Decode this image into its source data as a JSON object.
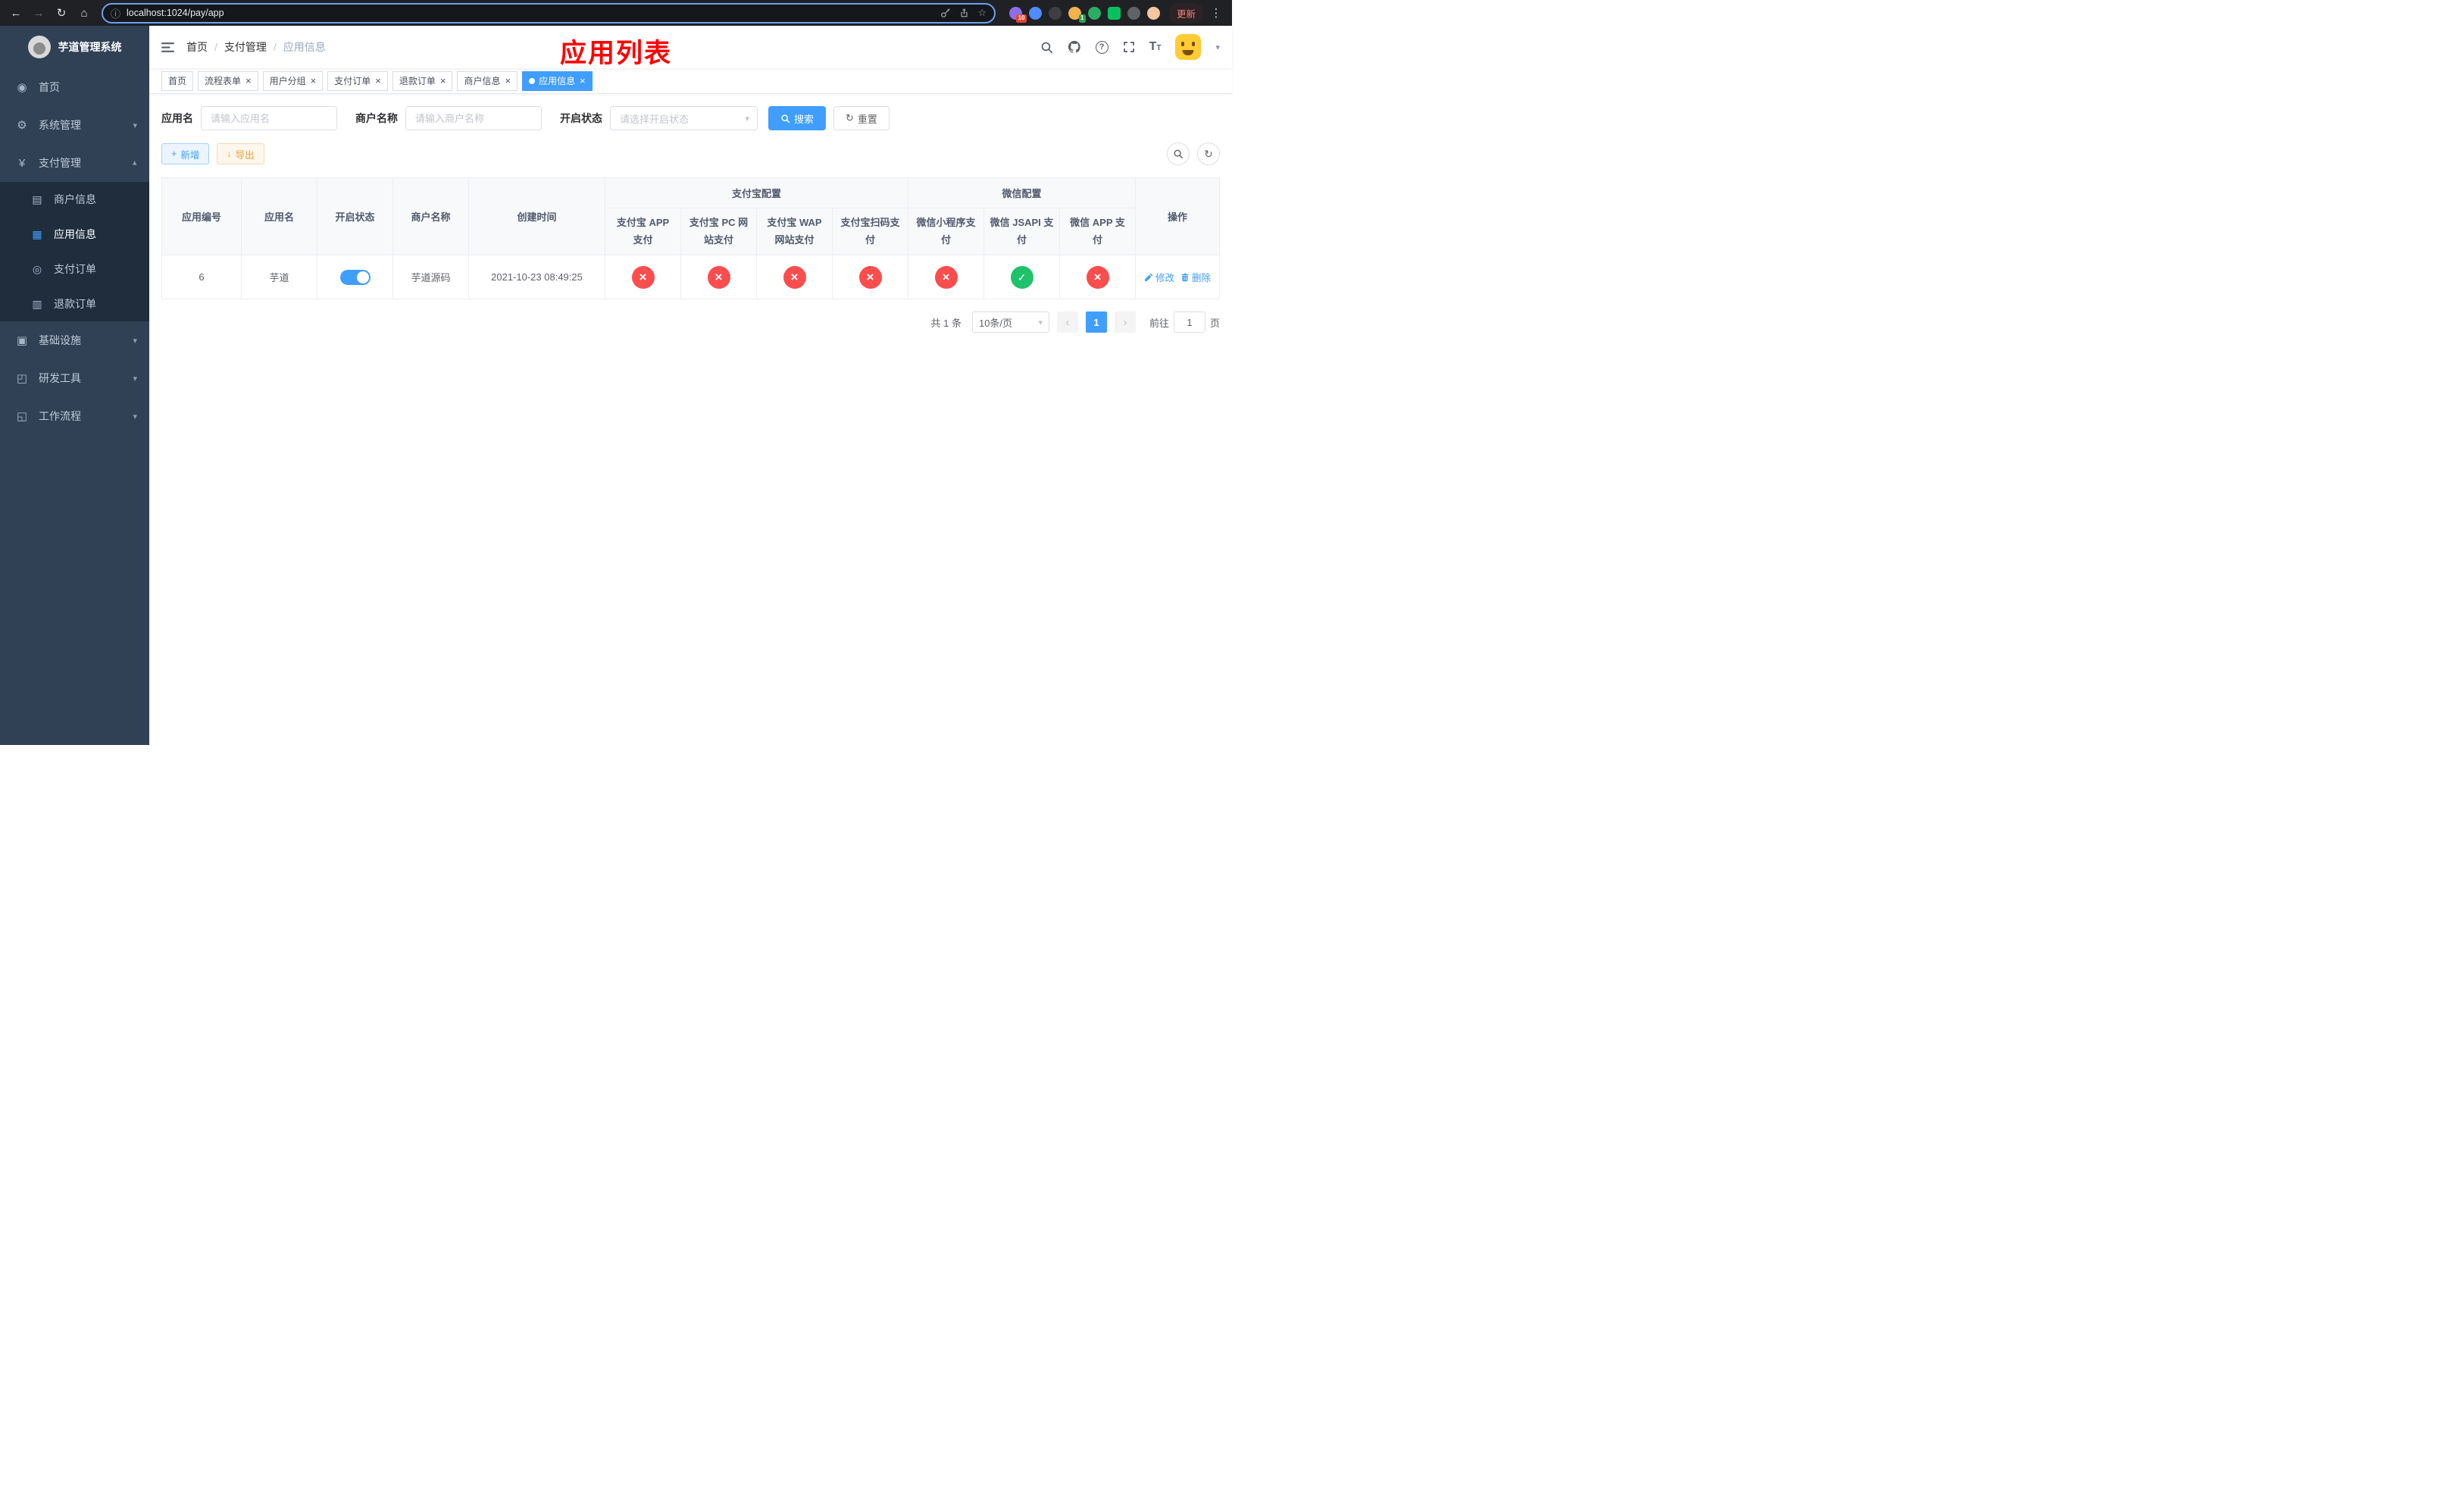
{
  "icons": {
    "back": "←",
    "forward": "→",
    "reload": "↻",
    "home": "⌂",
    "info": "ⓘ",
    "star": "☆",
    "kebab": "⋮",
    "close": "×",
    "caret_down": "▾",
    "check": "✓",
    "cross": "×",
    "plus": "+",
    "download": "↓",
    "refresh": "↻",
    "chevron_left": "‹",
    "chevron_right": "›",
    "question": "?"
  },
  "browser": {
    "url": "localhost:1024/pay/app",
    "update_button": "更新",
    "extensions": [
      {
        "name": "extensions-grid-icon",
        "color": "#8a6fe8",
        "badge": "10",
        "badge_color": "#e94235"
      },
      {
        "name": "extension-blue-icon",
        "color": "#4e8cff"
      },
      {
        "name": "extension-dark-circle-icon",
        "color": "#3c4043"
      },
      {
        "name": "extension-avatar-icon",
        "color": "#f2b24c",
        "badge": "1",
        "badge_color": "#2e9e4f"
      },
      {
        "name": "extension-green-circle-icon",
        "color": "#2aae67"
      },
      {
        "name": "extension-wechat-icon",
        "color": "#07c160",
        "square": true
      },
      {
        "name": "extension-gray-circle-icon",
        "color": "#5f6368"
      },
      {
        "name": "extension-profile-face-icon",
        "color": "#f4c7a0"
      }
    ]
  },
  "app": {
    "annotation": "应用列表",
    "colors": {
      "accent": "#409eff",
      "status_off": "#fb4d4d",
      "status_on": "#1fc26b",
      "annotation_red": "#ff0000",
      "export_orange": "#e6a23c"
    },
    "sidebar": {
      "logo_title": "芋道管理系统",
      "menu": [
        {
          "label": "首页",
          "icon": "dashboard-icon",
          "glyph": "◉",
          "type": "item"
        },
        {
          "label": "系统管理",
          "icon": "gear-icon",
          "glyph": "⚙",
          "type": "group",
          "expanded": false
        },
        {
          "label": "支付管理",
          "icon": "yen-icon",
          "glyph": "¥",
          "type": "group",
          "expanded": true,
          "children": [
            {
              "label": "商户信息",
              "icon": "merchant-card-icon",
              "glyph": "▤",
              "active": false
            },
            {
              "label": "应用信息",
              "icon": "app-grid-icon",
              "glyph": "▦",
              "active": true
            },
            {
              "label": "支付订单",
              "icon": "pay-order-icon",
              "glyph": "◎",
              "active": false
            },
            {
              "label": "退款订单",
              "icon": "refund-order-icon",
              "glyph": "▥",
              "active": false
            }
          ]
        },
        {
          "label": "基础设施",
          "icon": "infrastructure-icon",
          "glyph": "▣",
          "type": "group",
          "expanded": false
        },
        {
          "label": "研发工具",
          "icon": "devtools-box-icon",
          "glyph": "◰",
          "type": "group",
          "expanded": false
        },
        {
          "label": "工作流程",
          "icon": "workflow-box-icon",
          "glyph": "◱",
          "type": "group",
          "expanded": false
        }
      ]
    },
    "navbar": {
      "breadcrumb": [
        "首页",
        "支付管理",
        "应用信息"
      ],
      "breadcrumb_separator": "/"
    },
    "tabs": [
      {
        "label": "首页",
        "closable": false,
        "active": false
      },
      {
        "label": "流程表单",
        "closable": true,
        "active": false
      },
      {
        "label": "用户分组",
        "closable": true,
        "active": false
      },
      {
        "label": "支付订单",
        "closable": true,
        "active": false
      },
      {
        "label": "退款订单",
        "closable": true,
        "active": false
      },
      {
        "label": "商户信息",
        "closable": true,
        "active": false
      },
      {
        "label": "应用信息",
        "closable": true,
        "active": true
      }
    ],
    "filters": {
      "app_name_label": "应用名",
      "app_name_placeholder": "请输入应用名",
      "merchant_label": "商户名称",
      "merchant_placeholder": "请输入商户名称",
      "status_label": "开启状态",
      "status_placeholder": "请选择开启状态",
      "search_button": "搜索",
      "reset_button": "重置"
    },
    "toolbar": {
      "add_button": "新增",
      "export_button": "导出"
    },
    "table": {
      "columns_left": [
        "应用编号",
        "应用名",
        "开启状态",
        "商户名称",
        "创建时间"
      ],
      "group_headers": [
        {
          "label": "支付宝配置",
          "span": 4
        },
        {
          "label": "微信配置",
          "span": 3
        }
      ],
      "columns_alipay": [
        "支付宝 APP 支付",
        "支付宝 PC 网站支付",
        "支付宝 WAP 网站支付",
        "支付宝扫码支付"
      ],
      "columns_wechat": [
        "微信小程序支付",
        "微信 JSAPI 支付",
        "微信 APP 支付"
      ],
      "column_action": "操作",
      "rows": [
        {
          "app_id": "6",
          "app_name": "芋道",
          "status_on": true,
          "merchant_name": "芋道源码",
          "created_at": "2021-10-23 08:49:25",
          "channels": [
            "off",
            "off",
            "off",
            "off",
            "off",
            "on",
            "off"
          ],
          "actions": [
            "修改",
            "删除"
          ]
        }
      ]
    },
    "pagination": {
      "total_text": "共 1 条",
      "page_size": "10条/页",
      "current_page": "1",
      "goto_prefix": "前往",
      "goto_value": "1",
      "goto_suffix": "页"
    }
  }
}
